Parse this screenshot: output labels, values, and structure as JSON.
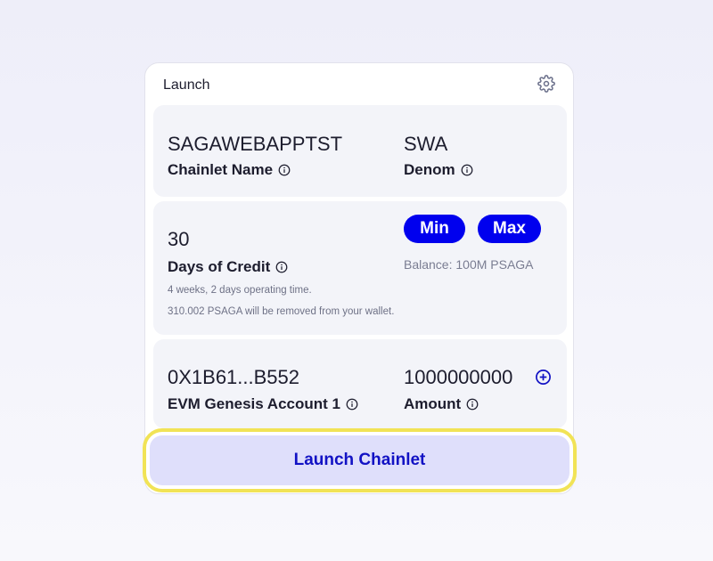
{
  "card": {
    "title": "Launch",
    "settings_icon": "gear-icon"
  },
  "chainlet": {
    "name_value": "SAGAWEBAPPTST",
    "name_label": "Chainlet Name",
    "denom_value": "SWA",
    "denom_label": "Denom"
  },
  "credit": {
    "days_value": "30",
    "days_label": "Days of Credit",
    "min_label": "Min",
    "max_label": "Max",
    "balance": "Balance: 100M PSAGA",
    "operating_note": "4 weeks, 2 days operating time.",
    "removal_note": "310.002 PSAGA will be removed from your wallet."
  },
  "genesis": {
    "account_value": "0X1B61...B552",
    "account_label": "EVM Genesis Account 1",
    "amount_value": "1000000000",
    "amount_label": "Amount",
    "add_icon": "plus-circle-icon"
  },
  "launch_button": {
    "label": "Launch Chainlet"
  },
  "colors": {
    "accent": "#0000ee",
    "launch_bg": "#dfdffb",
    "launch_text": "#1212c4",
    "highlight": "#f1e356"
  }
}
